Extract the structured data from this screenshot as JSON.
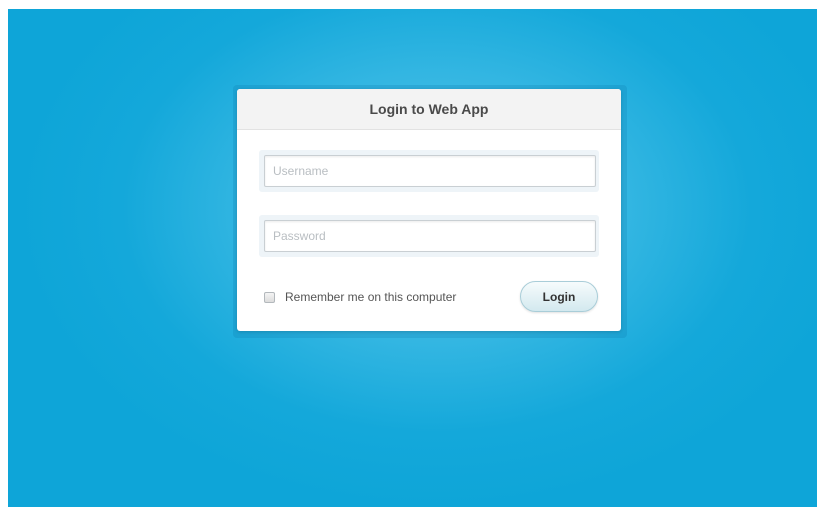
{
  "login_panel": {
    "title": "Login to Web App",
    "username": {
      "value": "",
      "placeholder": "Username"
    },
    "password": {
      "value": "",
      "placeholder": "Password"
    },
    "remember_label": "Remember me on this computer",
    "remember_checked": false,
    "submit_label": "Login"
  },
  "colors": {
    "background": "#0ea5d8",
    "background_glow": "#5cc8ec",
    "panel": "#ffffff",
    "header": "#f3f3f3",
    "button": "#d3e9ef"
  }
}
